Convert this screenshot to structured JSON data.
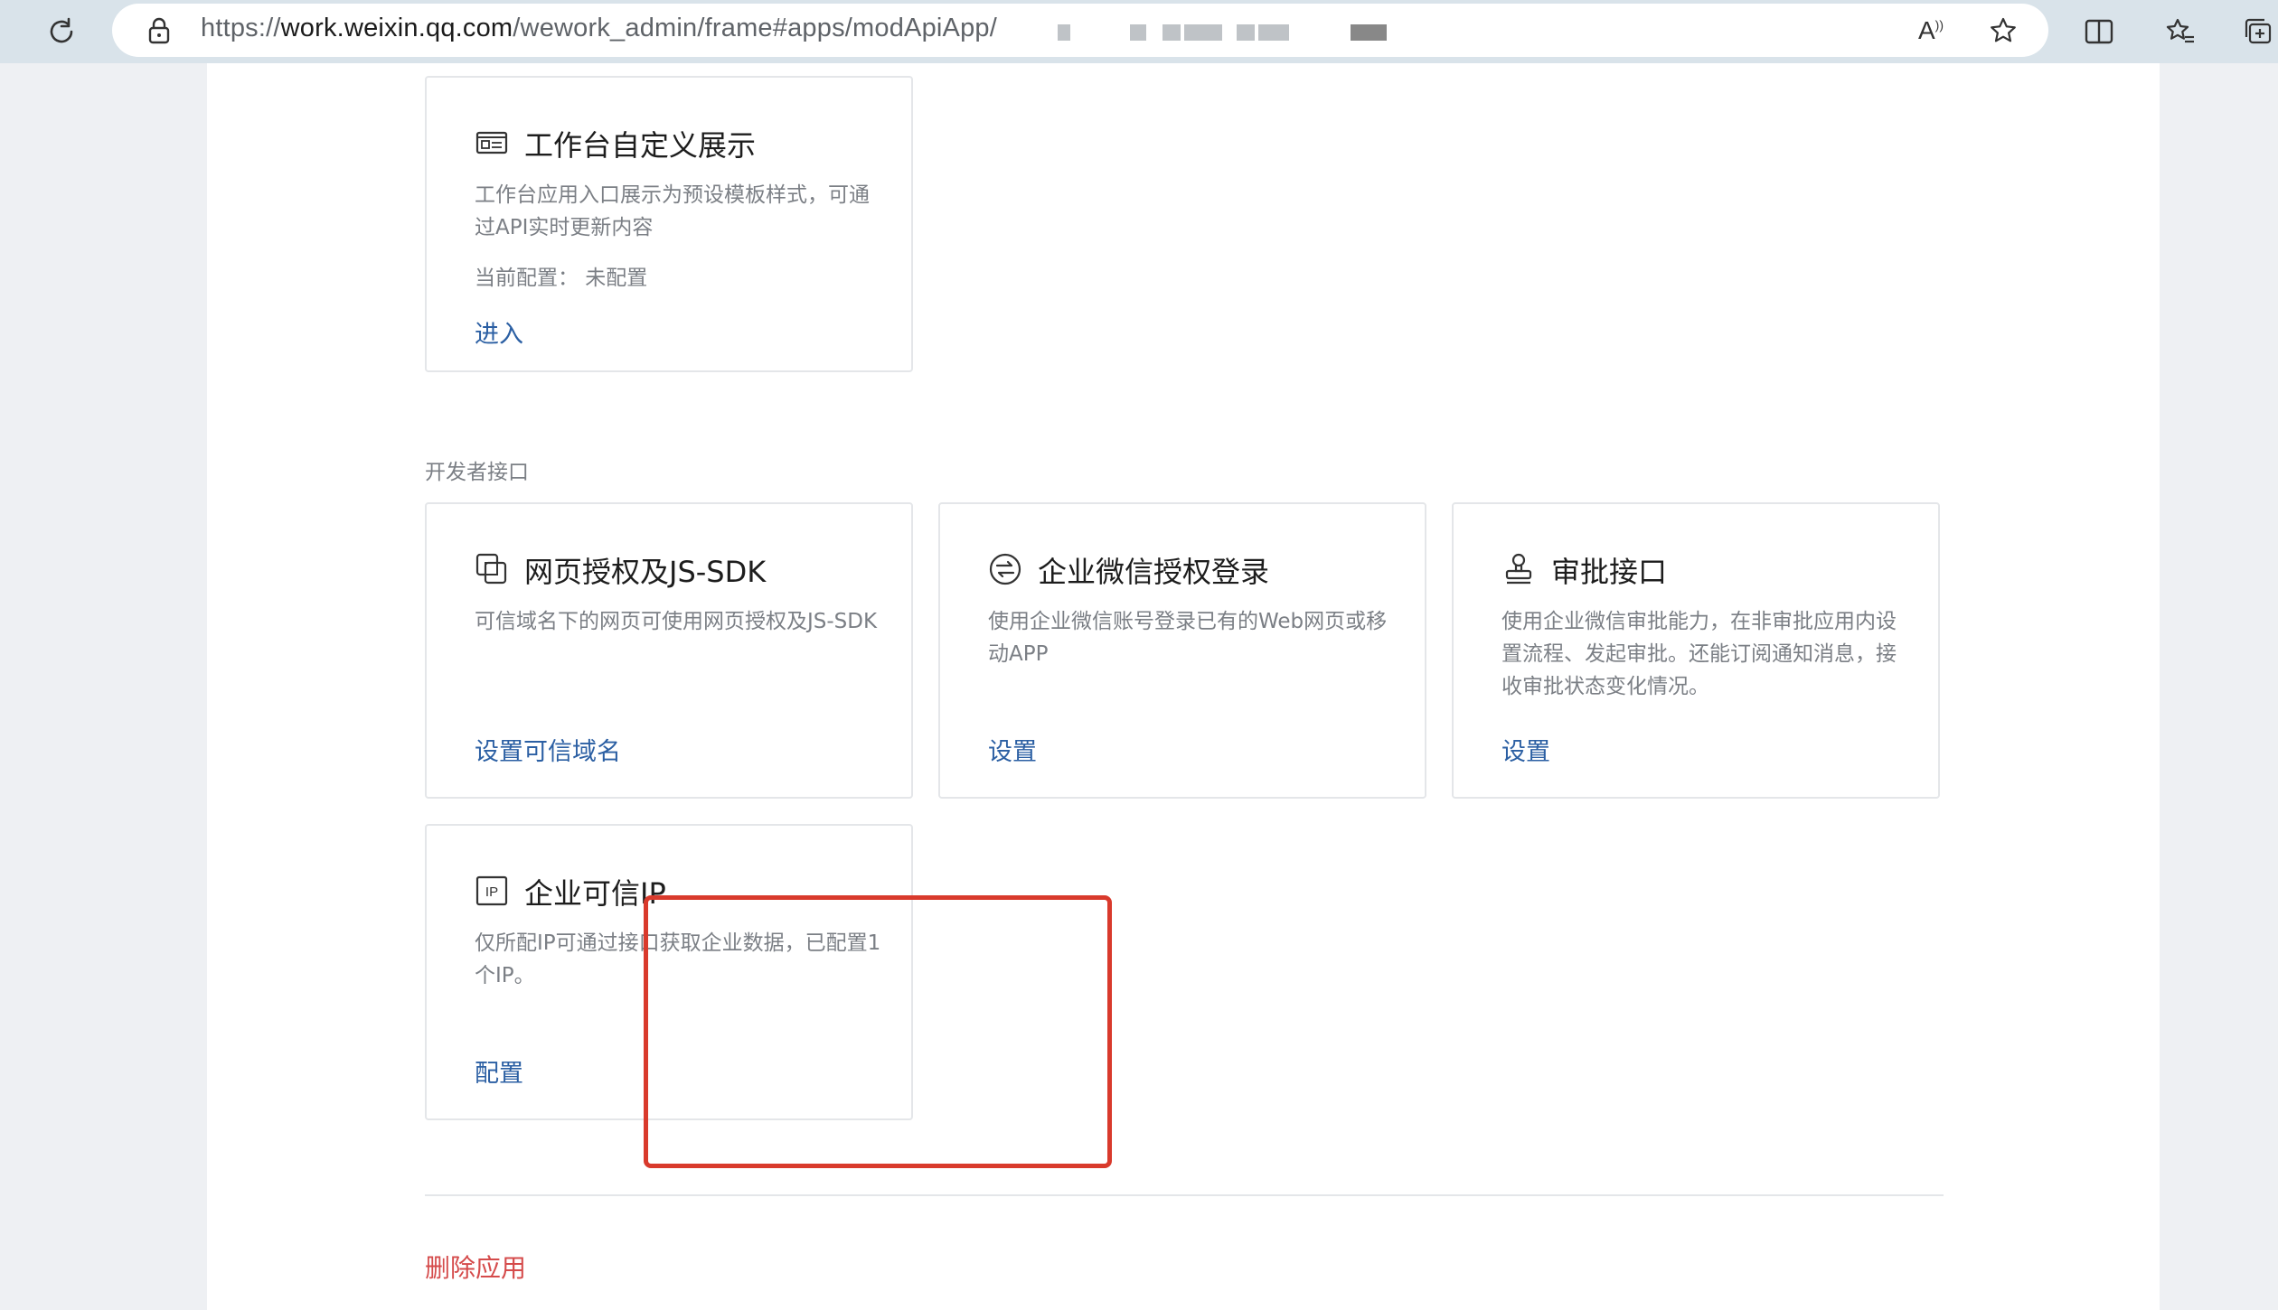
{
  "browser": {
    "url_prefix": "https://",
    "url_host": "work.weixin.qq.com",
    "url_path": "/wework_admin/frame#apps/modApiApp/",
    "icons": [
      "refresh-icon",
      "lock-icon",
      "read-aloud-icon",
      "favorite-star-icon",
      "split-screen-icon",
      "favorites-icon",
      "collections-icon"
    ]
  },
  "cards_top": [
    {
      "title": "工作台自定义展示",
      "desc": "工作台应用入口展示为预设模板样式，可通过API实时更新内容",
      "meta": "当前配置：  未配置",
      "link": "进入"
    }
  ],
  "section": {
    "label": "开发者接口"
  },
  "dev_cards": [
    {
      "title": "网页授权及JS-SDK",
      "desc": "可信域名下的网页可使用网页授权及JS-SDK",
      "link": "设置可信域名"
    },
    {
      "title": "企业微信授权登录",
      "desc": "使用企业微信账号登录已有的Web网页或移动APP",
      "link": "设置"
    },
    {
      "title": "审批接口",
      "desc": "使用企业微信审批能力，在非审批应用内设置流程、发起审批。还能订阅通知消息，接收审批状态变化情况。",
      "link": "设置"
    },
    {
      "title": "企业可信IP",
      "desc": "仅所配IP可通过接口获取企业数据，已配置1个IP。",
      "link": "配置"
    }
  ],
  "footer": {
    "delete_label": "删除应用"
  },
  "colors": {
    "link": "#2b5fa3",
    "danger": "#d54b4b",
    "highlight": "#d93a2c"
  }
}
